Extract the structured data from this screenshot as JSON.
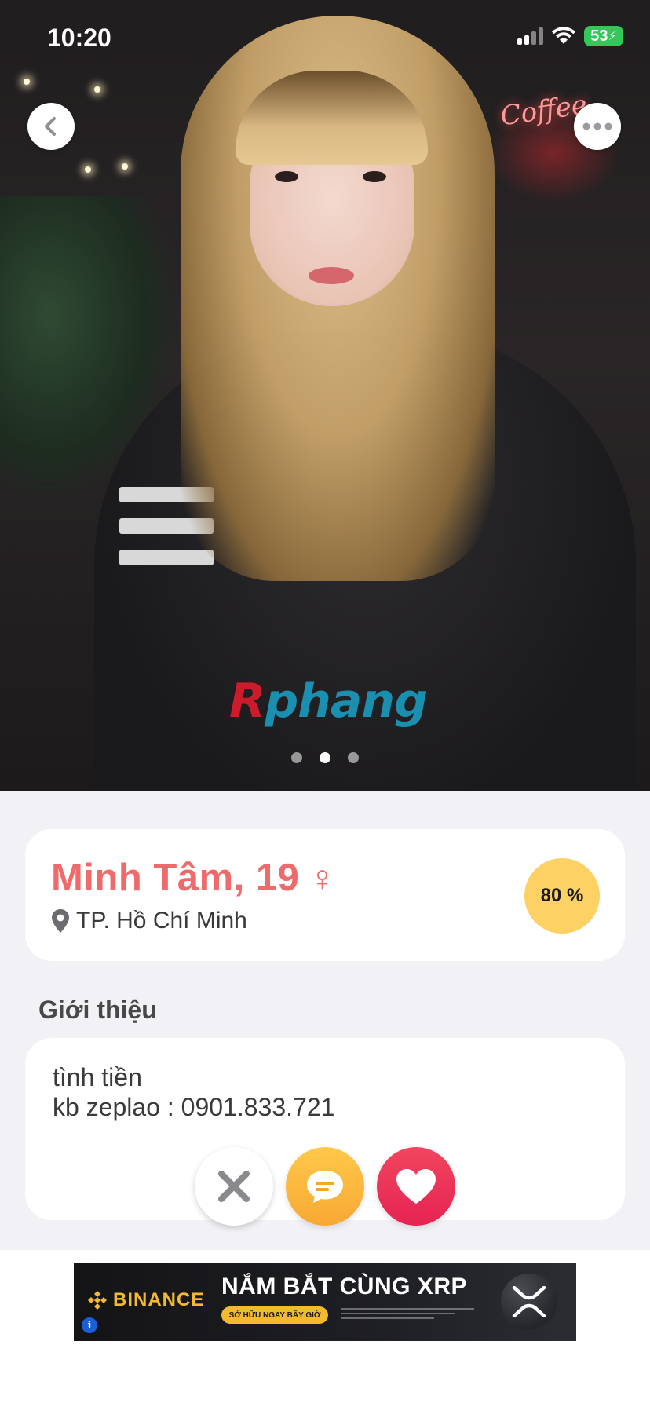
{
  "status_bar": {
    "time": "10:20",
    "battery": "53"
  },
  "photo": {
    "watermark_first": "R",
    "watermark_rest": "phang",
    "slide_count": 3,
    "active_slide": 2,
    "background_sign": "Coffee"
  },
  "profile": {
    "name_age": "Minh Tâm, 19",
    "gender_symbol": "♀",
    "location": "TP. Hồ Chí Minh",
    "match": "80 %"
  },
  "about": {
    "title": "Giới thiệu",
    "lines": [
      "tình tiền",
      "kb zeplao : 0901.833.721"
    ]
  },
  "ad": {
    "brand": "BINANCE",
    "headline": "NẮM BẮT CÙNG XRP",
    "cta": "SỞ HỮU NGAY BÂY GIỜ",
    "info": "i"
  },
  "icons": {
    "back": "chevron-left-icon",
    "more": "ellipsis-icon",
    "location": "map-pin-icon",
    "dislike": "close-icon",
    "chat": "chat-bubble-icon",
    "like": "heart-icon"
  },
  "colors": {
    "accent": "#ef6b6b",
    "match_badge": "#fdd164",
    "like": "#e52352",
    "chat": "#f7a833",
    "binance": "#f3ba2f"
  }
}
